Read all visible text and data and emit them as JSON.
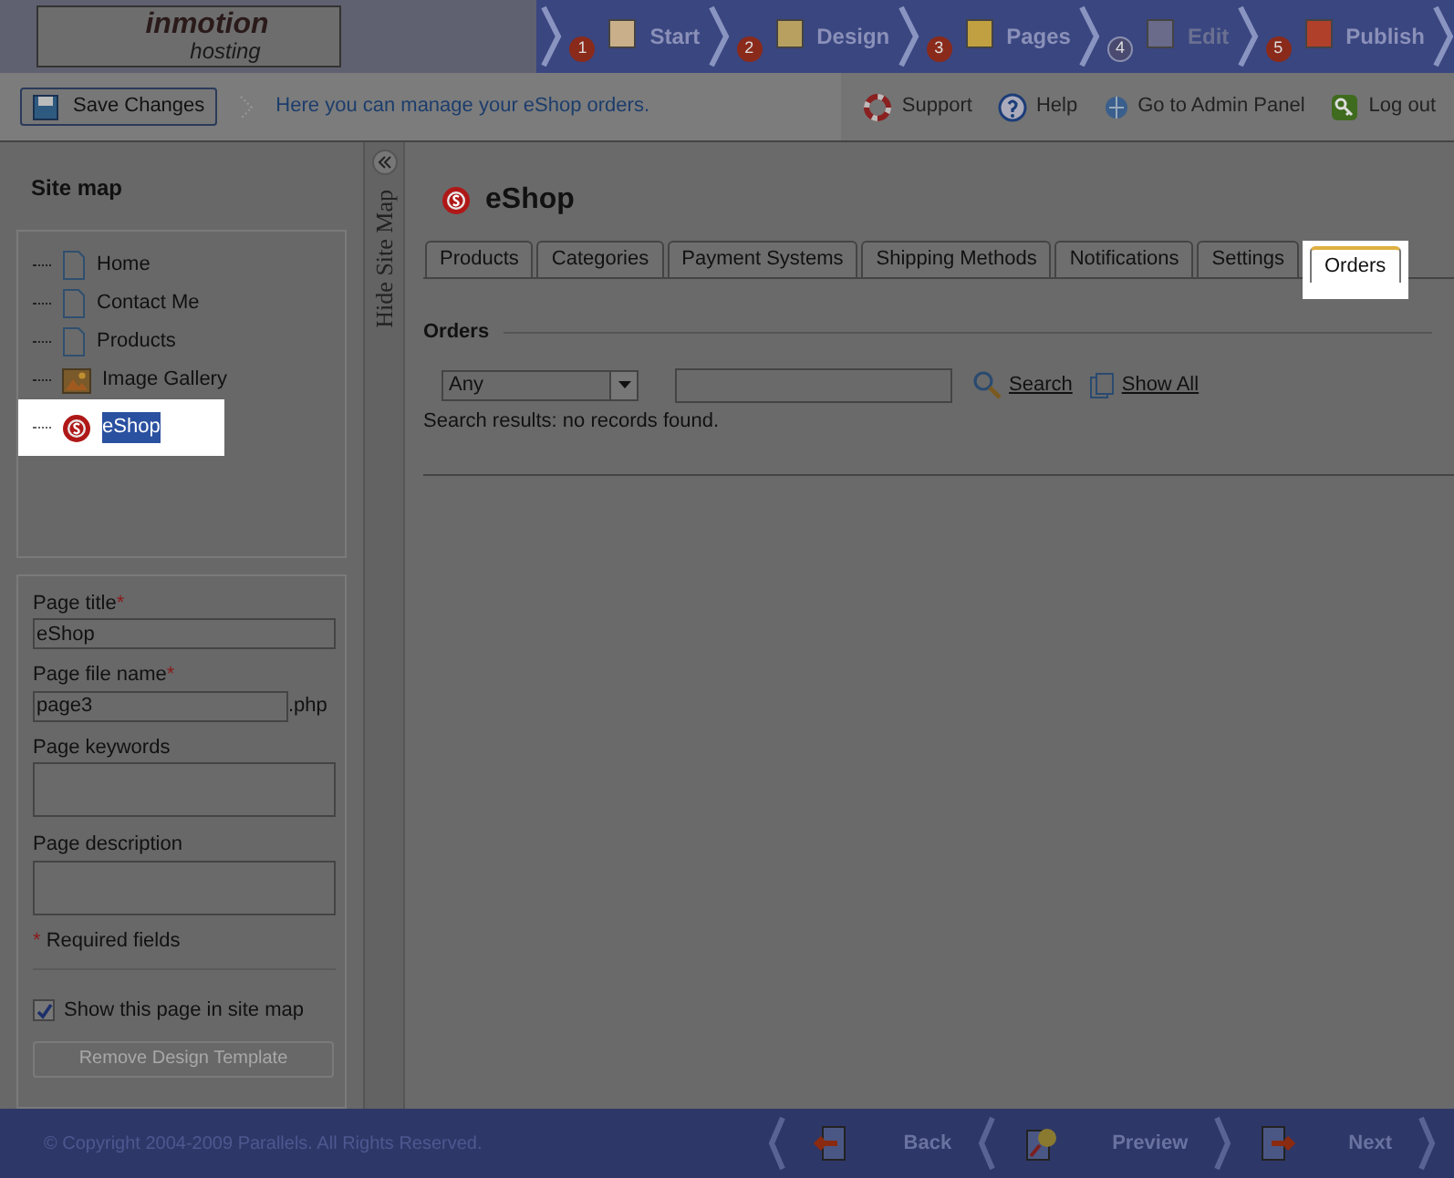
{
  "header": {
    "logo": {
      "line1": "inmotion",
      "line2": "hosting"
    },
    "steps": [
      {
        "number": "1",
        "label": "Start",
        "disabled": false
      },
      {
        "number": "2",
        "label": "Design",
        "disabled": false
      },
      {
        "number": "3",
        "label": "Pages",
        "disabled": false
      },
      {
        "number": "4",
        "label": "Edit",
        "disabled": true
      },
      {
        "number": "5",
        "label": "Publish",
        "disabled": false
      }
    ]
  },
  "toolbar": {
    "save_button": "Save Changes",
    "hint": "Here you can manage your eShop orders.",
    "links": [
      {
        "kind": "support",
        "label": "Support"
      },
      {
        "kind": "help",
        "label": "Help"
      },
      {
        "kind": "admin",
        "label": "Go to Admin Panel"
      },
      {
        "kind": "logout",
        "label": "Log out"
      }
    ]
  },
  "sitemap": {
    "title": "Site map",
    "hide_label": "Hide Site Map",
    "items": [
      {
        "kind": "page",
        "label": "Home",
        "selected": false
      },
      {
        "kind": "page",
        "label": "Contact Me",
        "selected": false
      },
      {
        "kind": "page",
        "label": "Products",
        "selected": false
      },
      {
        "kind": "gallery",
        "label": "Image Gallery",
        "selected": false
      },
      {
        "kind": "shop",
        "label": "eShop",
        "selected": true
      }
    ]
  },
  "page_form": {
    "required_mark": "*",
    "title_label": "Page title",
    "title_value": "eShop",
    "file_label": "Page file name",
    "file_value": "page3",
    "file_ext": ".php",
    "keywords_label": "Page keywords",
    "description_label": "Page description",
    "required_note": "Required fields",
    "show_in_map": {
      "label": "Show this page in site map",
      "checked": true
    },
    "remove_button": {
      "label": "Remove Design Template",
      "disabled": true
    }
  },
  "main": {
    "title": "eShop",
    "tabs": [
      {
        "label": "Products",
        "selected": false
      },
      {
        "label": "Categories",
        "selected": false
      },
      {
        "label": "Payment Systems",
        "selected": false
      },
      {
        "label": "Shipping Methods",
        "selected": false
      },
      {
        "label": "Notifications",
        "selected": false
      },
      {
        "label": "Settings",
        "selected": false
      },
      {
        "label": "Orders",
        "selected": true
      }
    ],
    "section": "Orders",
    "filter": "Any",
    "search_link": "Search",
    "show_all_link": "Show All",
    "result": "Search results: no records found."
  },
  "footer": {
    "copyright": "© Copyright 2004-2009 Parallels. All Rights Reserved.",
    "nav": [
      {
        "kind": "back",
        "label": "Back"
      },
      {
        "kind": "preview",
        "label": "Preview"
      },
      {
        "kind": "next",
        "label": "Next"
      }
    ]
  }
}
